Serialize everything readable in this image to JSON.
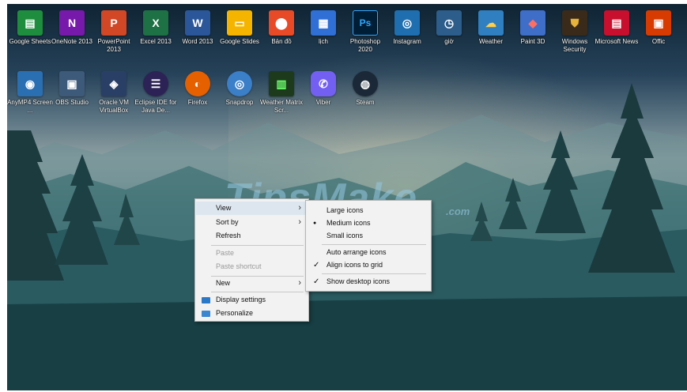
{
  "desktop_icons_row1": [
    {
      "label": "Google Sheets",
      "icon": "sheets-icon",
      "color": "#1e8e3e",
      "glyph": "▤"
    },
    {
      "label": "OneNote 2013",
      "icon": "onenote-icon",
      "color": "#7719aa",
      "glyph": "N"
    },
    {
      "label": "PowerPoint 2013",
      "icon": "powerpoint-icon",
      "color": "#d24726",
      "glyph": "P"
    },
    {
      "label": "Excel 2013",
      "icon": "excel-icon",
      "color": "#1e7145",
      "glyph": "X"
    },
    {
      "label": "Word 2013",
      "icon": "word-icon",
      "color": "#2b579a",
      "glyph": "W"
    },
    {
      "label": "Google Slides",
      "icon": "slides-icon",
      "color": "#f4b400",
      "glyph": "▭"
    },
    {
      "label": "Bản đồ",
      "icon": "maps-icon",
      "color": "#e84a27",
      "glyph": "⬤"
    },
    {
      "label": "lịch",
      "icon": "calendar-icon",
      "color": "#2f6fd6",
      "glyph": "▦"
    },
    {
      "label": "Photoshop 2020",
      "icon": "photoshop-icon",
      "color": "#001e36",
      "glyph": "Ps"
    },
    {
      "label": "Instagram",
      "icon": "instagram-icon",
      "color": "#1f6fb0",
      "glyph": "◎"
    },
    {
      "label": "giờ",
      "icon": "clock-icon",
      "color": "#2d5d8a",
      "glyph": "◷"
    },
    {
      "label": "Weather",
      "icon": "weather-icon",
      "color": "#2f7fc1",
      "glyph": "☁"
    },
    {
      "label": "Paint 3D",
      "icon": "paint3d-icon",
      "color": "#3f6ec9",
      "glyph": "◆"
    },
    {
      "label": "Windows Security",
      "icon": "shield-icon",
      "color": "#3a2a1a",
      "glyph": "⛊"
    },
    {
      "label": "Microsoft News",
      "icon": "news-icon",
      "color": "#c8102e",
      "glyph": "▤"
    },
    {
      "label": "Offic",
      "icon": "office-icon",
      "color": "#d83b01",
      "glyph": "▣"
    }
  ],
  "desktop_icons_row2": [
    {
      "label": "AnyMP4 Screen ...",
      "icon": "screen-recorder-icon",
      "color": "#2b6fb3",
      "glyph": "◉"
    },
    {
      "label": "OBS Studio",
      "icon": "obs-icon",
      "color": "#3e5a7a",
      "glyph": "▣"
    },
    {
      "label": "Oracle VM VirtualBox",
      "icon": "virtualbox-icon",
      "color": "#2a3f66",
      "glyph": "◈"
    },
    {
      "label": "Eclipse IDE for Java De...",
      "icon": "eclipse-icon",
      "color": "#2c2255",
      "glyph": "☰"
    },
    {
      "label": "Firefox",
      "icon": "firefox-icon",
      "color": "#e66000",
      "glyph": "◐"
    },
    {
      "label": "Snapdrop",
      "icon": "snapdrop-icon",
      "color": "#3a7fc8",
      "glyph": "◎"
    },
    {
      "label": "Weather Matrix Scr...",
      "icon": "matrix-icon",
      "color": "#1d3a1d",
      "glyph": "▥"
    },
    {
      "label": "Viber",
      "icon": "viber-icon",
      "color": "#7360f2",
      "glyph": "✆"
    },
    {
      "label": "Steam",
      "icon": "steam-icon",
      "color": "#1b2838",
      "glyph": "◍"
    }
  ],
  "watermark": {
    "text": "TipsMake",
    "suffix": ".com"
  },
  "context_menu": {
    "view": "View",
    "sort_by": "Sort by",
    "refresh": "Refresh",
    "paste": "Paste",
    "paste_shortcut": "Paste shortcut",
    "new": "New",
    "display_settings": "Display settings",
    "personalize": "Personalize"
  },
  "view_submenu": {
    "large_icons": "Large icons",
    "medium_icons": "Medium icons",
    "small_icons": "Small icons",
    "auto_arrange": "Auto arrange icons",
    "align_grid": "Align icons to grid",
    "show_desktop_icons": "Show desktop icons"
  },
  "glyphs": {
    "chevron": "›",
    "check": "✓",
    "bullet": "●"
  }
}
